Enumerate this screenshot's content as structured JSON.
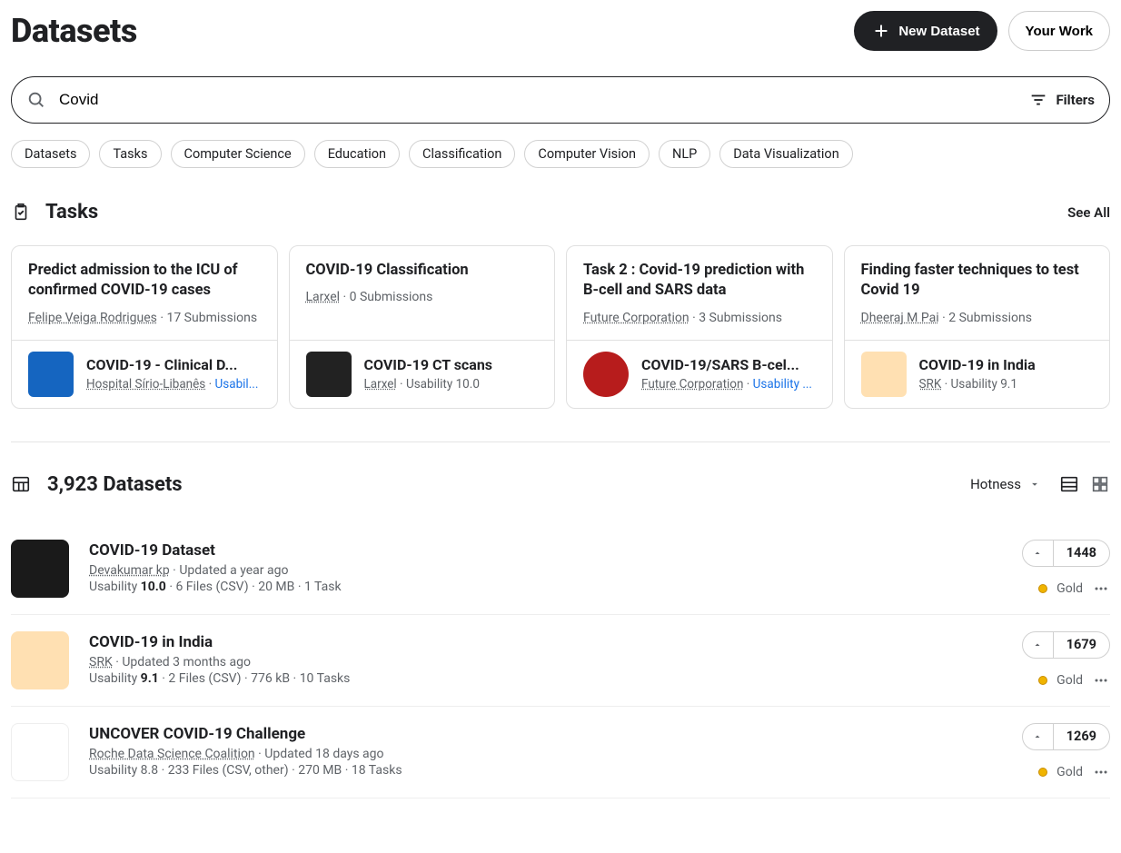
{
  "header": {
    "title": "Datasets",
    "new_dataset": "New Dataset",
    "your_work": "Your Work"
  },
  "search": {
    "value": "Covid",
    "filters": "Filters"
  },
  "chips": [
    "Datasets",
    "Tasks",
    "Computer Science",
    "Education",
    "Classification",
    "Computer Vision",
    "NLP",
    "Data Visualization"
  ],
  "tasks": {
    "title": "Tasks",
    "see_all": "See All",
    "cards": [
      {
        "title": "Predict admission to the ICU of confirmed COVID-19 cases",
        "author": "Felipe Veiga Rodrigues",
        "subs": "17 Submissions",
        "ds_title": "COVID-19 - Clinical D...",
        "ds_author": "Hospital Sírio-Libanês",
        "ds_usab": "Usabil...",
        "thumb": "blue",
        "usab_blue": true
      },
      {
        "title": "COVID-19 Classification",
        "author": "Larxel",
        "subs": "0 Submissions",
        "ds_title": "COVID-19 CT scans",
        "ds_author": "Larxel",
        "ds_usab": "Usability 10.0",
        "thumb": "ct"
      },
      {
        "title": "Task 2 : Covid-19 prediction with B-cell and SARS data",
        "author": "Future Corporation",
        "subs": "3 Submissions",
        "ds_title": "COVID-19/SARS B-cel...",
        "ds_author": "Future Corporation",
        "ds_usab": "Usability ...",
        "thumb": "virus",
        "usab_blue": true
      },
      {
        "title": "Finding faster techniques to test Covid 19",
        "author": "Dheeraj M Pai",
        "subs": "2 Submissions",
        "ds_title": "COVID-19 in India",
        "ds_author": "SRK",
        "ds_usab": "Usability 9.1",
        "thumb": "map"
      }
    ]
  },
  "datasets_section": {
    "count_title": "3,923 Datasets",
    "sort": "Hotness"
  },
  "datasets": [
    {
      "title": "COVID-19 Dataset",
      "author": "Devakumar kp",
      "updated": "Updated a year ago",
      "usability_label": "Usability",
      "usability_val": "10.0",
      "files": "6 Files (CSV)",
      "size": "20 MB",
      "tasks": "1 Task",
      "votes": "1448",
      "medal": "Gold",
      "thumb": "dark"
    },
    {
      "title": "COVID-19 in India",
      "author": "SRK",
      "updated": "Updated 3 months ago",
      "usability_label": "Usability",
      "usability_val": "9.1",
      "files": "2 Files (CSV)",
      "size": "776 kB",
      "tasks": "10 Tasks",
      "votes": "1679",
      "medal": "Gold",
      "thumb": "map"
    },
    {
      "title": "UNCOVER COVID-19 Challenge",
      "author": "Roche Data Science Coalition",
      "updated": "Updated 18 days ago",
      "usability_label": "Usability 8.8",
      "usability_val": "",
      "files": "233 Files (CSV, other)",
      "size": "270 MB",
      "tasks": "18 Tasks",
      "votes": "1269",
      "medal": "Gold",
      "thumb": "virus"
    }
  ]
}
